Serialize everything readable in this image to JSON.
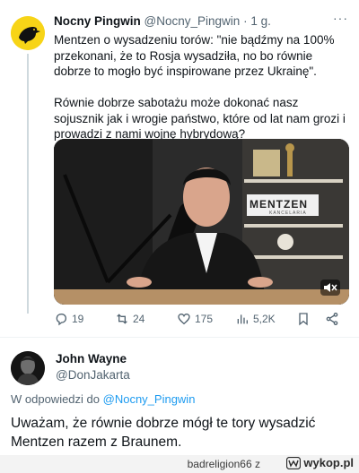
{
  "tweet": {
    "display_name": "Nocny Pingwin",
    "handle": "@Nocny_Pingwin",
    "separator": "·",
    "time": "1 g.",
    "more_label": "···",
    "text": "Mentzen o wysadzeniu torów: \"nie bądźmy na 100% przekonani, że to Rosja wysadziła, no bo równie dobrze to mogło być inspirowane przez Ukrainę\".\n\nRównie dobrze sabotażu może dokonać nasz sojusznik jak i wrogie państwo, które od lat nam grozi i prowadzi z nami wojnę hybrydową?",
    "video": {
      "wall_logo": "MENTZEN",
      "wall_sublogo": "KANCELARIA",
      "mute_icon": "mute-icon"
    },
    "actions": {
      "replies": "19",
      "retweets": "24",
      "likes": "175",
      "views": "5,2K"
    }
  },
  "reply": {
    "display_name": "John Wayne",
    "handle": "@DonJakarta",
    "replying_prefix": "W odpowiedzi do",
    "replying_to": "@Nocny_Pingwin",
    "text": "Uważam, że równie dobrze mógł te tory wysadzić Mentzen razem z Braunem."
  },
  "footer": {
    "user_tag": "badreligion66  z",
    "brand": "wykop.pl"
  },
  "colors": {
    "accent": "#1d9bf0",
    "muted": "#536471",
    "avatar_yellow": "#f7d417"
  }
}
